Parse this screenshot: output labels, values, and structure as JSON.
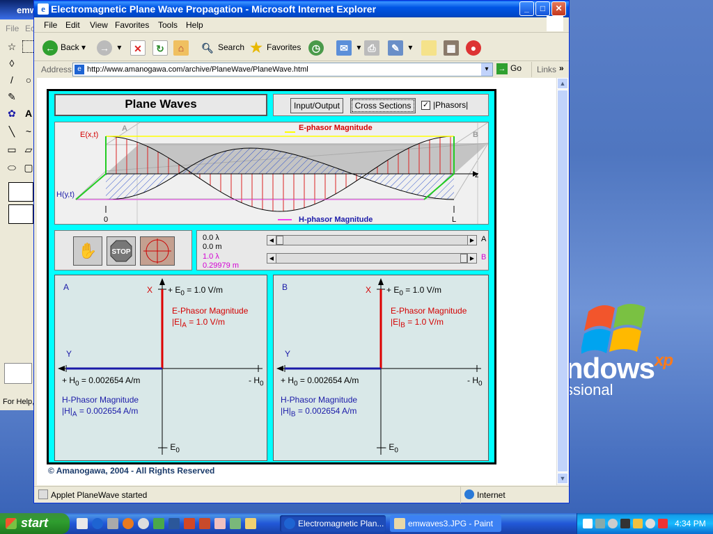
{
  "paint": {
    "title": "emwaves3.JPG - Paint",
    "title_short": "emw",
    "menu": [
      "File",
      "Ec"
    ],
    "status": "For Help,"
  },
  "desktop": {
    "xp_word": "ndows",
    "xp_sup": "xp",
    "xp_sub": "ssional"
  },
  "window": {
    "title": "Electromagnetic Plane Wave Propagation - Microsoft Internet Explorer",
    "menu": [
      "File",
      "Edit",
      "View",
      "Favorites",
      "Tools",
      "Help"
    ],
    "toolbar": {
      "back": "Back",
      "search": "Search",
      "favorites": "Favorites"
    },
    "address_label": "Address",
    "url": "http://www.amanogawa.com/archive/PlaneWave/PlaneWave.html",
    "go": "Go",
    "links": "Links",
    "status": "Applet PlaneWave started",
    "zone": "Internet"
  },
  "applet": {
    "title": "Plane Waves",
    "btn_io": "Input/Output",
    "btn_cross": "Cross Sections",
    "phasors_label": "|Phasors|",
    "phasors_checked": true,
    "wave": {
      "e_label": "E(x,t)",
      "h_label": "H(y,t)",
      "e_legend": "E-phasor Magnitude",
      "h_legend": "H-phasor Magnitude",
      "z": "z",
      "zero": "0",
      "L": "L",
      "A": "A",
      "B": "B"
    },
    "sliders": {
      "a_lambda": "0.0 λ",
      "a_m": "0.0 m",
      "b_lambda": "1.0 λ",
      "b_m": "0.29979 m",
      "a_letter": "A",
      "b_letter": "B",
      "a_fraction": 0.0,
      "b_fraction": 1.0
    },
    "phasorA": {
      "id": "A",
      "x": "X",
      "y": "Y",
      "e_top": "E",
      "e_top_suffix": " = 1.0 V/m",
      "e_title": "E-Phasor Magnitude",
      "e_mag_pre": "|E|",
      "e_mag_sub": "A",
      "e_mag_val": " = 1.0 V/m",
      "h_left": "+ H",
      "h_left_suffix": " = 0.002654 A/m",
      "h_right": "- H",
      "h_title": "H-Phasor Magnitude",
      "h_mag_pre": "|H|",
      "h_mag_sub": "A",
      "h_mag_val": " = 0.002654 A/m",
      "e_bottom": "- E"
    },
    "phasorB": {
      "id": "B",
      "x": "X",
      "y": "Y",
      "e_top": "E",
      "e_top_suffix": " = 1.0 V/m",
      "e_title": "E-Phasor Magnitude",
      "e_mag_pre": "|E|",
      "e_mag_sub": "B",
      "e_mag_val": " = 1.0 V/m",
      "h_left": "+ H",
      "h_left_suffix": " = 0.002654 A/m",
      "h_right": "- H",
      "h_title": "H-Phasor Magnitude",
      "h_mag_pre": "|H|",
      "h_mag_sub": "B",
      "h_mag_val": " = 0.002654 A/m",
      "e_bottom": "- E"
    },
    "copyright": "© Amanogawa, 2004 - All Rights Reserved"
  },
  "taskbar": {
    "start": "start",
    "tasks": [
      "Electromagnetic Plan...",
      "emwaves3.JPG - Paint"
    ],
    "clock": "4:34 PM"
  }
}
